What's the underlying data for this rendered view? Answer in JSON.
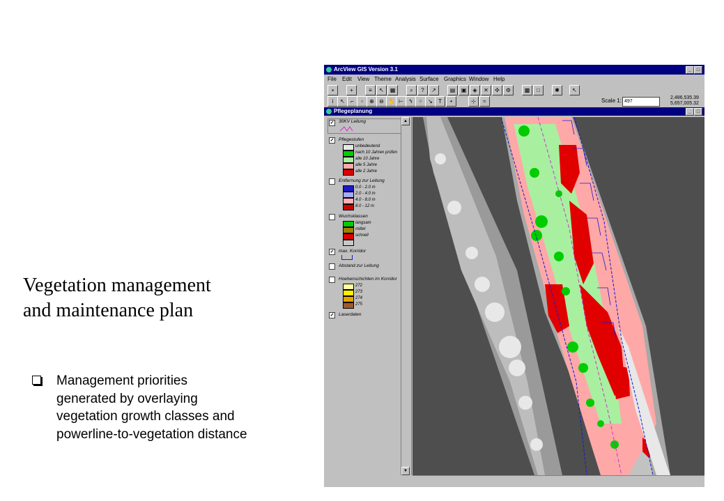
{
  "slide": {
    "title_lines": [
      "Vegetation management",
      "and maintenance plan"
    ],
    "bullet_lines": [
      "Management priorities",
      "generated by overlaying",
      "vegetation growth classes and",
      "powerline-to-vegetation distance"
    ]
  },
  "app": {
    "title": "ArcView GIS Version 3.1",
    "menu": [
      "File",
      "Edit",
      "View",
      "Theme",
      "Analysis",
      "Surface",
      "Graphics",
      "Window",
      "Help"
    ],
    "scale_label": "Scale 1:",
    "scale_value": "497",
    "coords": [
      "2,486,535.39",
      "5,657,005.32"
    ]
  },
  "view": {
    "title": "Pflegeplanung",
    "themes": [
      {
        "name": "30KV Leitung",
        "checked": true,
        "legend": []
      },
      {
        "name": "Pflegestufen",
        "checked": true,
        "legend": [
          {
            "label": "unbedeutend",
            "color": "#e8e8e8"
          },
          {
            "label": "nach 10 Jahren prüfen",
            "color": "#00cc00"
          },
          {
            "label": "alle 10 Jahre",
            "color": "#a8f0a0"
          },
          {
            "label": "alle 5 Jahre",
            "color": "#ffa8a8"
          },
          {
            "label": "alle 2 Jahre",
            "color": "#e00000"
          }
        ]
      },
      {
        "name": "Entfernung zur Leitung",
        "checked": false,
        "legend": [
          {
            "label": "0.0 - 2.0 m",
            "color": "#1a1acc"
          },
          {
            "label": "2.0 - 4.0 m",
            "color": "#a8a8ff"
          },
          {
            "label": "4.0 - 8.0 m",
            "color": "#ffb0b0"
          },
          {
            "label": "8.0 - 12 m",
            "color": "#cc0000"
          }
        ]
      },
      {
        "name": "Wuchsklassen",
        "checked": false,
        "legend": [
          {
            "label": "langsam",
            "color": "#00cc00"
          },
          {
            "label": "mittel",
            "color": "#a08000"
          },
          {
            "label": "schnell",
            "color": "#dd0000"
          },
          {
            "label": "",
            "color": "#c8c8c8"
          }
        ]
      },
      {
        "name": "max. Korridor",
        "checked": true,
        "legend": []
      },
      {
        "name": "Abstand zur Leitung",
        "checked": false,
        "legend": []
      },
      {
        "name": "Hoehenschichten im Korridor",
        "checked": false,
        "legend": [
          {
            "label": "272",
            "color": "#ffffa0"
          },
          {
            "label": "273",
            "color": "#ffee00"
          },
          {
            "label": "274",
            "color": "#e8a000"
          },
          {
            "label": "275",
            "color": "#a05a28"
          }
        ]
      },
      {
        "name": "Laserdaten",
        "checked": true,
        "legend": []
      }
    ]
  },
  "colors": {
    "titlebar": "#000080",
    "window_bg": "#c0c0c0",
    "map_bg": "#505050",
    "corridor_line": "#1a1acc",
    "powerline": "#cc33cc"
  }
}
